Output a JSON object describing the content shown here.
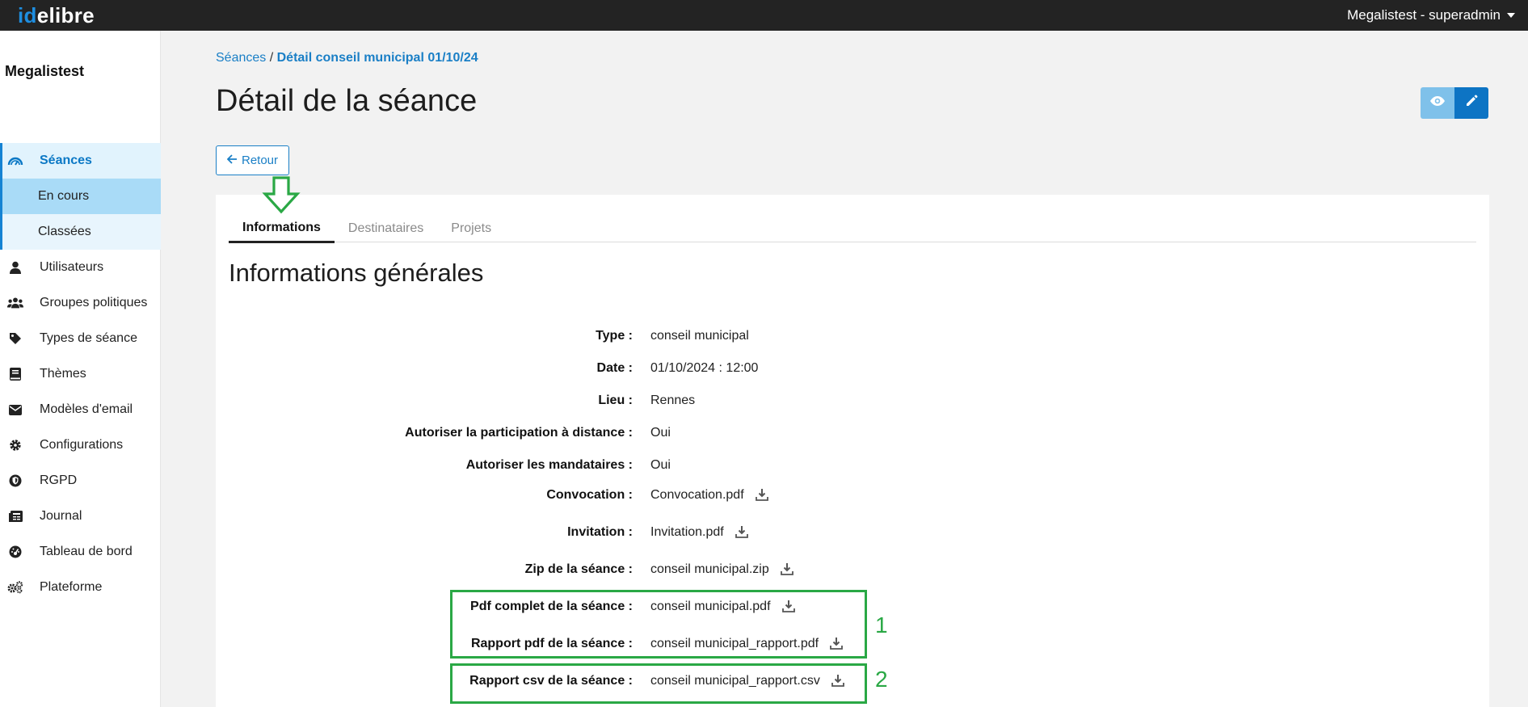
{
  "app": {
    "logo_prefix": "id",
    "logo_rest": "elibre",
    "user": "Megalistest - superadmin"
  },
  "sidebar": {
    "org_name": "Megalistest",
    "section": {
      "label": "Séances",
      "icon": "gauge-icon"
    },
    "sub_items": [
      {
        "label": "En cours"
      },
      {
        "label": "Classées"
      }
    ],
    "items": [
      {
        "label": "Utilisateurs",
        "icon": "user-icon"
      },
      {
        "label": "Groupes politiques",
        "icon": "users-icon"
      },
      {
        "label": "Types de séance",
        "icon": "tag-icon"
      },
      {
        "label": "Thèmes",
        "icon": "book-icon"
      },
      {
        "label": "Modèles d'email",
        "icon": "envelope-icon"
      },
      {
        "label": "Configurations",
        "icon": "gear-icon"
      },
      {
        "label": "RGPD",
        "icon": "shield-icon"
      },
      {
        "label": "Journal",
        "icon": "journal-icon"
      },
      {
        "label": "Tableau de bord",
        "icon": "dashboard-icon"
      },
      {
        "label": "Plateforme",
        "icon": "gears-icon"
      }
    ]
  },
  "breadcrumb": {
    "parent": "Séances",
    "separator": " / ",
    "current": "Détail conseil municipal 01/10/24"
  },
  "page": {
    "title": "Détail de la séance",
    "back_label": "Retour"
  },
  "tabs": [
    {
      "label": "Informations"
    },
    {
      "label": "Destinataires"
    },
    {
      "label": "Projets"
    }
  ],
  "section_title": "Informations générales",
  "fields": [
    {
      "label": "Type :",
      "value": "conseil municipal"
    },
    {
      "label": "Date :",
      "value": "01/10/2024 : 12:00"
    },
    {
      "label": "Lieu :",
      "value": "Rennes"
    },
    {
      "label": "Autoriser la participation à distance :",
      "value": "Oui"
    },
    {
      "label": "Autoriser les mandataires :",
      "value": "Oui"
    },
    {
      "label": "Convocation :",
      "value": "Convocation.pdf"
    },
    {
      "label": "Invitation :",
      "value": "Invitation.pdf"
    },
    {
      "label": "Zip de la séance :",
      "value": "conseil municipal.zip"
    },
    {
      "label": "Pdf complet de la séance :",
      "value": "conseil municipal.pdf"
    },
    {
      "label": "Rapport pdf de la séance :",
      "value": "conseil municipal_rapport.pdf"
    },
    {
      "label": "Rapport csv de la séance :",
      "value": "conseil municipal_rapport.csv"
    }
  ],
  "annotations": {
    "box1": "1",
    "box2": "2"
  },
  "colors": {
    "accent": "#1a7fc6",
    "highlight": "#2aa845",
    "topbar": "#232323"
  }
}
